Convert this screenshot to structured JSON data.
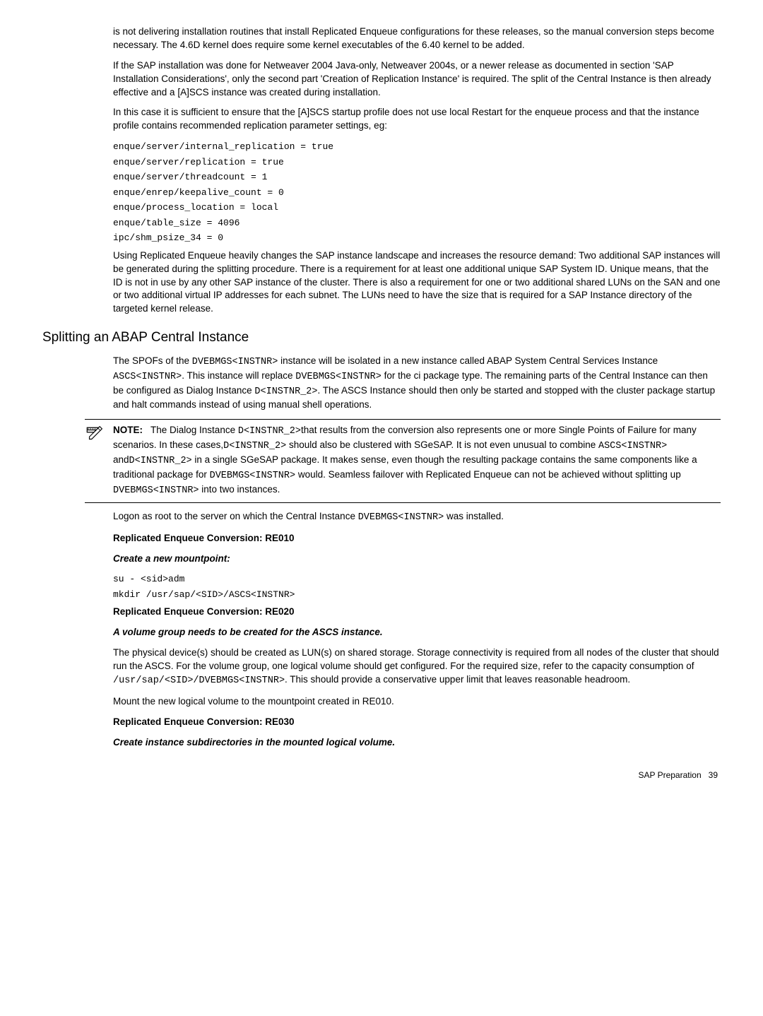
{
  "intro": {
    "p1": "is not delivering installation routines that install Replicated Enqueue configurations for these releases, so the manual conversion steps become necessary. The 4.6D kernel does require some kernel executables of the 6.40 kernel to be added.",
    "p2": "If the SAP installation was done for Netweaver 2004 Java-only, Netweaver 2004s, or a newer release as documented in section 'SAP Installation Considerations', only the second part 'Creation of Replication Instance' is required. The split of the Central Instance is then already effective and a [A]SCS instance was created during installation.",
    "p3": "In this case it is sufficient to ensure that the [A]SCS startup profile does not use local Restart for the enqueue process and that the instance profile contains recommended replication parameter settings, eg:",
    "code1": "enque/server/internal_replication = true",
    "code2": "enque/server/replication = true",
    "code3": "enque/server/threadcount = 1",
    "code4": "enque/enrep/keepalive_count = 0",
    "code5": "enque/process_location = local",
    "code6": "enque/table_size = 4096",
    "code7": "ipc/shm_psize_34 = 0",
    "p4": "Using Replicated Enqueue heavily changes the SAP instance landscape and increases the resource demand: Two additional SAP instances will be generated during the splitting procedure. There is a requirement for at least one additional unique SAP System ID. Unique means, that the ID is not in use by any other SAP instance of the cluster. There is also a requirement for one or two additional shared LUNs on the SAN and one or two additional virtual IP addresses for each subnet. The LUNs need to have the size that is required for a SAP Instance directory of the targeted kernel release."
  },
  "heading": "Splitting an ABAP Central Instance",
  "split": {
    "p1a": "The SPOFs of the ",
    "p1b": " instance will be isolated in a new instance called ABAP System Central Services Instance ",
    "p1c": ". This instance will replace ",
    "p1d": " for the ci package type. The remaining parts of the Central Instance can then be configured as Dialog Instance ",
    "p1e": ". The ASCS Instance should then only be started and stopped with the cluster package startup and halt commands instead of using manual shell operations.",
    "c1": "DVEBMGS<INSTNR>",
    "c2": "ASCS<INSTNR>",
    "c3": "DVEBMGS<INSTNR>",
    "c4": "D<INSTNR_2>"
  },
  "note": {
    "label": "NOTE:",
    "t1": "The Dialog Instance ",
    "c1": "D<INSTNR_2>",
    "t2": "that results from the conversion also represents one or more Single Points of Failure for many scenarios. In these cases,",
    "c2": "D<INSTNR_2>",
    "t3": " should also be clustered with SGeSAP. It is not even unusual to combine ",
    "c3": "ASCS<INSTNR>",
    "t4": " and",
    "c4": "D<INSTNR_2>",
    "t5": " in a single SGeSAP package. It makes sense, even though the resulting package contains the same components like a traditional package for ",
    "c5": "DVEBMGS<INSTNR>",
    "t6": " would. Seamless failover with Replicated Enqueue can not be achieved without splitting up ",
    "c6": "DVEBMGS<INSTNR>",
    "t7": " into two instances."
  },
  "after": {
    "p1a": "Logon as root to the server on which the Central Instance ",
    "p1b": " was installed.",
    "p1c": "DVEBMGS<INSTNR>",
    "h1": "Replicated Enqueue Conversion: RE010",
    "h2": "Create a new mountpoint:",
    "code1": "su - <sid>adm",
    "code2": "mkdir /usr/sap/<SID>/ASCS<INSTNR>",
    "h3": "Replicated Enqueue Conversion: RE020",
    "h4": "A volume group needs to be created for the ASCS instance.",
    "p2": "The physical device(s) should be created as LUN(s) on shared storage. Storage connectivity is required from all nodes of the cluster that should run the ASCS. For the volume group, one logical volume should get configured. For the required size, refer to the capacity consumption of",
    "p2code": "/usr/sap/<SID>/DVEBMGS<INSTNR>",
    "p2b": ". This should provide a conservative upper limit that leaves reasonable headroom.",
    "p3": "Mount the new logical volume to the mountpoint created in RE010.",
    "h5": "Replicated Enqueue Conversion: RE030",
    "h6": "Create instance subdirectories in the mounted logical volume."
  },
  "footer": {
    "label": "SAP Preparation",
    "page": "39"
  }
}
